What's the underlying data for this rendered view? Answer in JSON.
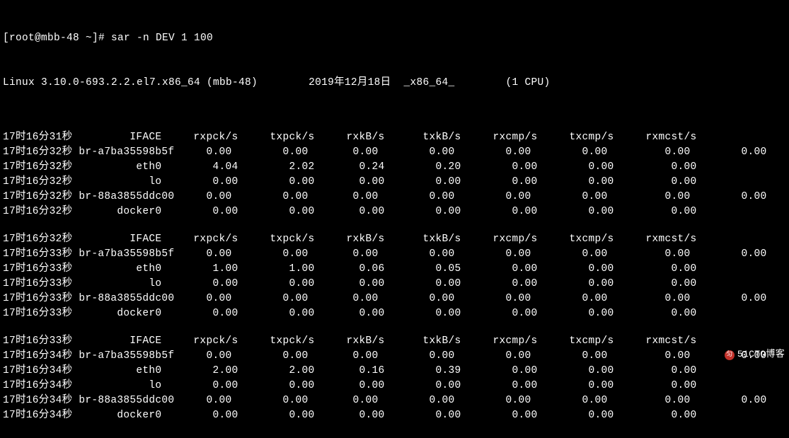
{
  "prompt": "[root@mbb-48 ~]# sar -n DEV 1 100",
  "info_line": "Linux 3.10.0-693.2.2.el7.x86_64 (mbb-48)        2019年12月18日  _x86_64_        (1 CPU)",
  "headers": [
    "IFACE",
    "rxpck/s",
    "txpck/s",
    "rxkB/s",
    "txkB/s",
    "rxcmp/s",
    "txcmp/s",
    "rxmcst/s"
  ],
  "blocks": [
    {
      "header_time": "17时16分31秒",
      "rows": [
        {
          "time": "17时16分32秒",
          "iface": "br-a7ba35598b5f",
          "vals": [
            "0.00",
            "0.00",
            "0.00",
            "0.00",
            "0.00",
            "0.00",
            "0.00",
            "0.00"
          ],
          "wide": true
        },
        {
          "time": "17时16分32秒",
          "iface": "eth0",
          "vals": [
            "4.04",
            "2.02",
            "0.24",
            "0.20",
            "0.00",
            "0.00",
            "0.00"
          ],
          "wide": false
        },
        {
          "time": "17时16分32秒",
          "iface": "lo",
          "vals": [
            "0.00",
            "0.00",
            "0.00",
            "0.00",
            "0.00",
            "0.00",
            "0.00"
          ],
          "wide": false
        },
        {
          "time": "17时16分32秒",
          "iface": "br-88a3855ddc00",
          "vals": [
            "0.00",
            "0.00",
            "0.00",
            "0.00",
            "0.00",
            "0.00",
            "0.00",
            "0.00"
          ],
          "wide": true
        },
        {
          "time": "17时16分32秒",
          "iface": "docker0",
          "vals": [
            "0.00",
            "0.00",
            "0.00",
            "0.00",
            "0.00",
            "0.00",
            "0.00"
          ],
          "wide": false
        }
      ]
    },
    {
      "header_time": "17时16分32秒",
      "rows": [
        {
          "time": "17时16分33秒",
          "iface": "br-a7ba35598b5f",
          "vals": [
            "0.00",
            "0.00",
            "0.00",
            "0.00",
            "0.00",
            "0.00",
            "0.00",
            "0.00"
          ],
          "wide": true
        },
        {
          "time": "17时16分33秒",
          "iface": "eth0",
          "vals": [
            "1.00",
            "1.00",
            "0.06",
            "0.05",
            "0.00",
            "0.00",
            "0.00"
          ],
          "wide": false
        },
        {
          "time": "17时16分33秒",
          "iface": "lo",
          "vals": [
            "0.00",
            "0.00",
            "0.00",
            "0.00",
            "0.00",
            "0.00",
            "0.00"
          ],
          "wide": false
        },
        {
          "time": "17时16分33秒",
          "iface": "br-88a3855ddc00",
          "vals": [
            "0.00",
            "0.00",
            "0.00",
            "0.00",
            "0.00",
            "0.00",
            "0.00",
            "0.00"
          ],
          "wide": true
        },
        {
          "time": "17时16分33秒",
          "iface": "docker0",
          "vals": [
            "0.00",
            "0.00",
            "0.00",
            "0.00",
            "0.00",
            "0.00",
            "0.00"
          ],
          "wide": false
        }
      ]
    },
    {
      "header_time": "17时16分33秒",
      "rows": [
        {
          "time": "17时16分34秒",
          "iface": "br-a7ba35598b5f",
          "vals": [
            "0.00",
            "0.00",
            "0.00",
            "0.00",
            "0.00",
            "0.00",
            "0.00",
            "0.00"
          ],
          "wide": true
        },
        {
          "time": "17时16分34秒",
          "iface": "eth0",
          "vals": [
            "2.00",
            "2.00",
            "0.16",
            "0.39",
            "0.00",
            "0.00",
            "0.00"
          ],
          "wide": false
        },
        {
          "time": "17时16分34秒",
          "iface": "lo",
          "vals": [
            "0.00",
            "0.00",
            "0.00",
            "0.00",
            "0.00",
            "0.00",
            "0.00"
          ],
          "wide": false
        },
        {
          "time": "17时16分34秒",
          "iface": "br-88a3855ddc00",
          "vals": [
            "0.00",
            "0.00",
            "0.00",
            "0.00",
            "0.00",
            "0.00",
            "0.00",
            "0.00"
          ],
          "wide": true
        },
        {
          "time": "17时16分34秒",
          "iface": "docker0",
          "vals": [
            "0.00",
            "0.00",
            "0.00",
            "0.00",
            "0.00",
            "0.00",
            "0.00"
          ],
          "wide": false
        }
      ]
    }
  ],
  "watermark": "51CTO博客"
}
